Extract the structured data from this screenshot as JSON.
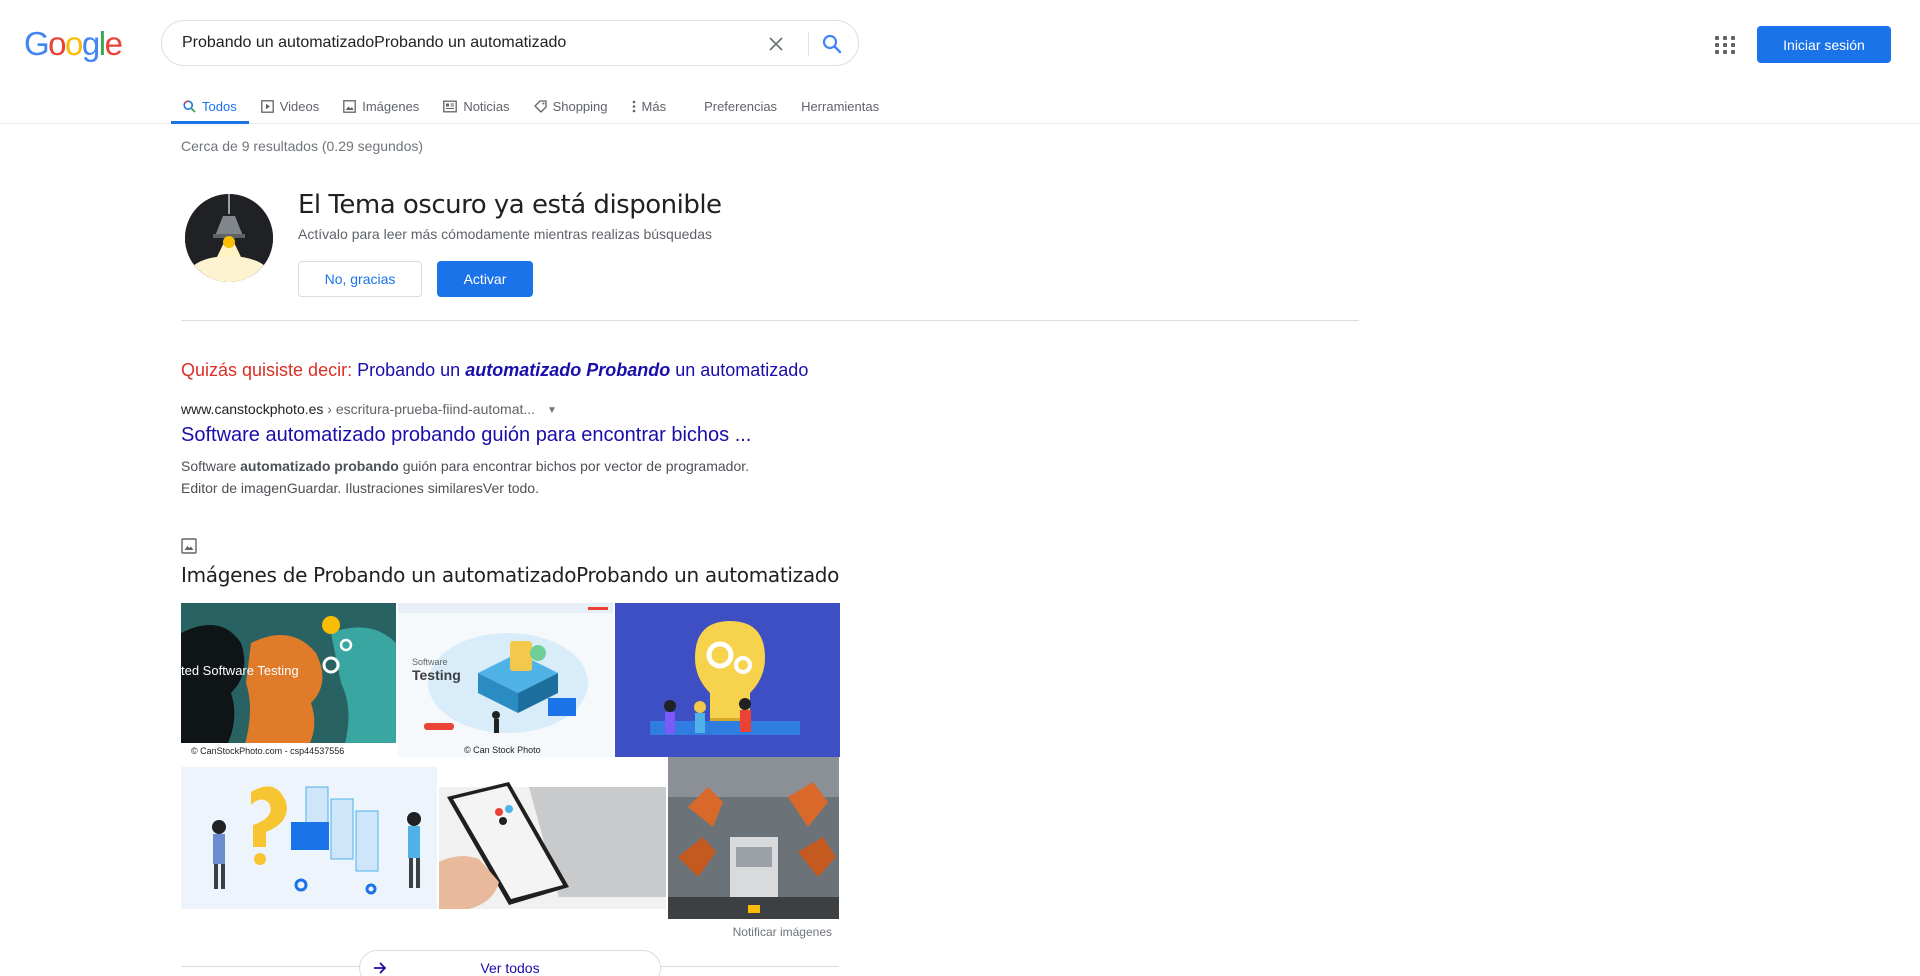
{
  "logo": {
    "text": "Google"
  },
  "search": {
    "query": "Probando un automatizadoProbando un automatizado"
  },
  "header": {
    "signin_label": "Iniciar sesión"
  },
  "tabs": [
    {
      "label": "Todos",
      "active": true
    },
    {
      "label": "Videos"
    },
    {
      "label": "Imágenes"
    },
    {
      "label": "Noticias"
    },
    {
      "label": "Shopping"
    },
    {
      "label": "Más"
    },
    {
      "label": "Preferencias"
    },
    {
      "label": "Herramientas"
    }
  ],
  "result_stats": "Cerca de 9 resultados (0.29 segundos)",
  "promo": {
    "title": "El Tema oscuro ya está disponible",
    "subtitle": "Actívalo para leer más cómodamente mientras realizas búsquedas",
    "decline_label": "No, gracias",
    "accept_label": "Activar"
  },
  "did_you_mean": {
    "label": "Quizás quisiste decir:",
    "part1": "Probando un",
    "bold1": "automatizado Probando",
    "part2": "un automatizado"
  },
  "result": {
    "domain": "www.canstockphoto.es",
    "breadcrumb": "› escritura-prueba-fiind-automat...",
    "title": "Software automatizado probando guión para encontrar bichos ...",
    "snippet_pre": "Software",
    "snippet_bold": "automatizado probando",
    "snippet_post": "guión para encontrar bichos por vector de programador.",
    "snippet_line2": "Editor de imagenGuardar. Ilustraciones similaresVer todo."
  },
  "images": {
    "heading": "Imágenes de Probando un automatizadoProbando un automatizado",
    "tile1_text": "ted Software Testing",
    "tile1_caption": "© CanStockPhoto.com - csp44537556",
    "tile2_title": "Software",
    "tile2_title2": "Testing",
    "tile2_caption": "© Can Stock Photo",
    "report_label": "Notificar imágenes",
    "see_all_label": "Ver todos"
  },
  "colors": {
    "accent": "#1a73e8",
    "link": "#1a0dab",
    "error_red": "#d93025"
  }
}
